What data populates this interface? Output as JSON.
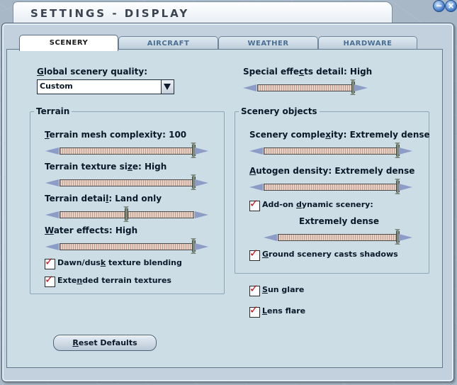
{
  "window": {
    "title": "SETTINGS - DISPLAY",
    "minimize_glyph": "−",
    "close_glyph": "×"
  },
  "tabs": [
    {
      "label": "SCENERY",
      "active": true
    },
    {
      "label": "AIRCRAFT",
      "active": false
    },
    {
      "label": "WEATHER",
      "active": false
    },
    {
      "label": "HARDWARE",
      "active": false
    }
  ],
  "global_quality": {
    "label_pre": "",
    "label_key": "G",
    "label_post": "lobal scenery quality:",
    "selected": "Custom"
  },
  "special_effects": {
    "label_pre": "Special effe",
    "label_key": "c",
    "label_post": "ts detail: High",
    "level": 1.0
  },
  "terrain": {
    "title": "Terrain",
    "mesh": {
      "label_pre": "",
      "label_key": "T",
      "label_post": "errain mesh complexity: 100",
      "level": 1.0
    },
    "texture": {
      "label_pre": "Terrain texture si",
      "label_key": "z",
      "label_post": "e: High",
      "level": 1.0
    },
    "detail": {
      "label_pre": "Terrain detai",
      "label_key": "l",
      "label_post": ": Land only",
      "level": 0.5
    },
    "water": {
      "label_pre": "",
      "label_key": "W",
      "label_post": "ater effects: High",
      "level": 1.0
    },
    "dawn_dusk": {
      "label_pre": "Dawn/dus",
      "label_key": "k",
      "label_post": " texture blending",
      "checked": true
    },
    "extended": {
      "label_pre": "Exte",
      "label_key": "n",
      "label_post": "ded terrain textures",
      "checked": true
    }
  },
  "scenery_objects": {
    "title": "Scenery objects",
    "complexity": {
      "label_pre": "Scenery comple",
      "label_key": "x",
      "label_post": "ity: Extremely dense",
      "level": 1.0
    },
    "autogen": {
      "label_pre": "",
      "label_key": "A",
      "label_post": "utogen density: Extremely dense",
      "level": 1.0
    },
    "addon": {
      "label_pre": "Add-on ",
      "label_key": "d",
      "label_post": "ynamic scenery:",
      "checked": true
    },
    "addon_value": "Extremely dense",
    "addon_level": 1.0,
    "ground_shadows": {
      "label_pre": "",
      "label_key": "G",
      "label_post": "round scenery casts shadows",
      "checked": true
    }
  },
  "sun_glare": {
    "label_pre": "",
    "label_key": "S",
    "label_post": "un glare",
    "checked": true
  },
  "lens_flare": {
    "label_pre": "",
    "label_key": "L",
    "label_post": "ens flare",
    "checked": true
  },
  "reset_button": {
    "label_pre": "",
    "label_key": "R",
    "label_post": "eset Defaults"
  },
  "check_glyph": "✓"
}
